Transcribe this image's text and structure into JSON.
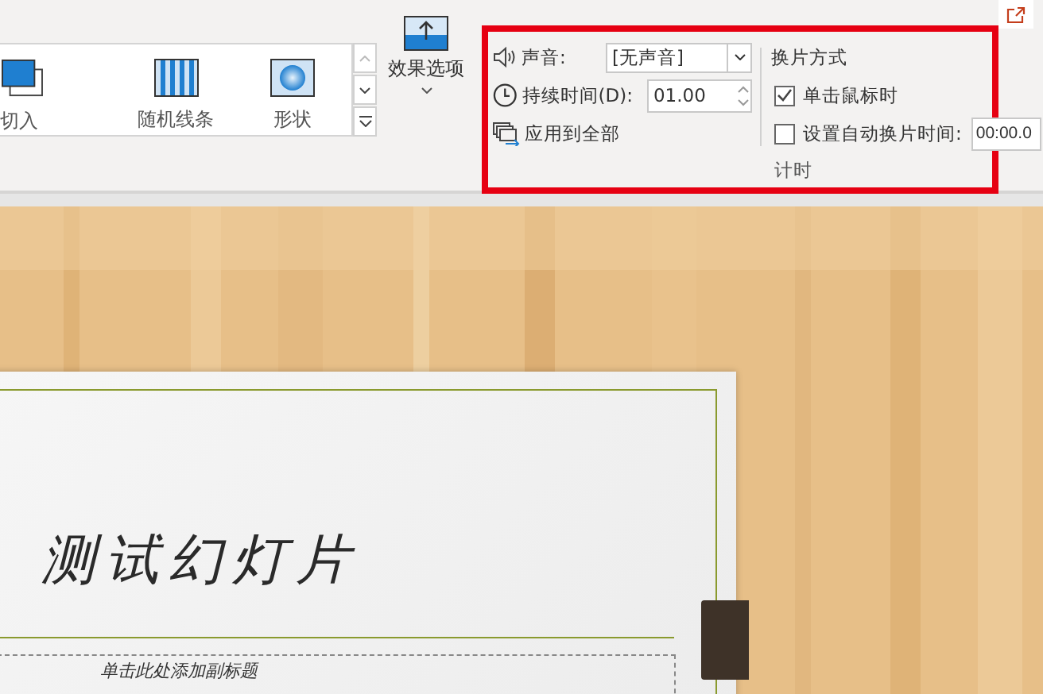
{
  "transitions": [
    {
      "label": "切入",
      "kind": "cut"
    },
    {
      "label": "随机线条",
      "kind": "bars"
    },
    {
      "label": "形状",
      "kind": "shape"
    }
  ],
  "effect_options": {
    "label": "效果选项"
  },
  "timing": {
    "sound_label": "声音:",
    "sound_value": "[无声音]",
    "duration_label": "持续时间(D):",
    "duration_value": "01.00",
    "apply_all": "应用到全部",
    "advance_title": "换片方式",
    "on_click": {
      "label": "单击鼠标时",
      "checked": true
    },
    "after_time": {
      "label": "设置自动换片时间:",
      "checked": false,
      "value": "00:00.0"
    },
    "group_label": "计时"
  },
  "slide": {
    "title": "测试幻灯片",
    "subtitle": "单击此处添加副标题"
  }
}
